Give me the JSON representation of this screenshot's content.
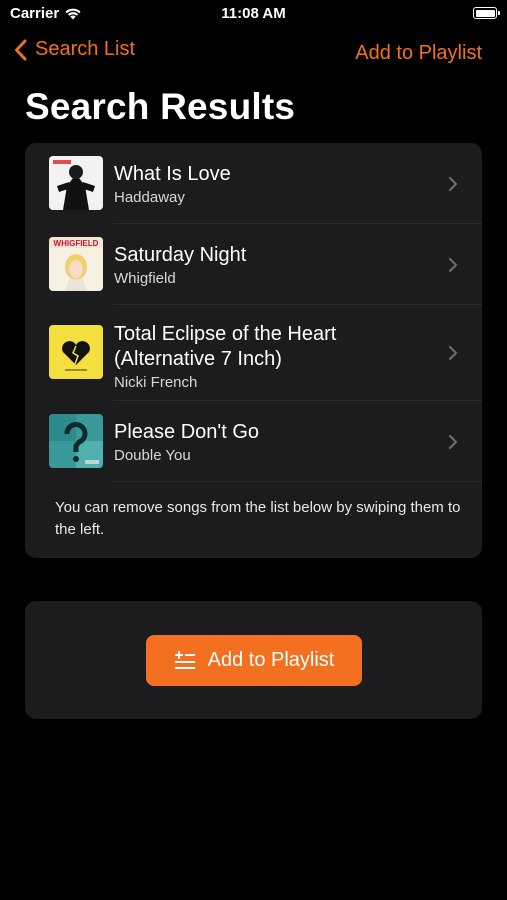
{
  "status_bar": {
    "carrier": "Carrier",
    "time": "11:08 AM",
    "wifi_icon": "wifi-icon",
    "battery_icon": "battery-icon"
  },
  "nav": {
    "back_label": "Search List",
    "back_icon": "chevron-left-icon",
    "action_label": "Add to Playlist"
  },
  "page_title": "Search Results",
  "songs": [
    {
      "title": "What Is Love",
      "artist": "Haddaway",
      "art_icon": "album-art"
    },
    {
      "title": "Saturday Night",
      "artist": "Whigfield",
      "art_icon": "album-art",
      "art_text": "WHIGFIELD"
    },
    {
      "title": "Total Eclipse of the Heart",
      "title_line2": "(Alternative 7 Inch)",
      "artist": "Nicki French",
      "art_icon": "album-art"
    },
    {
      "title": "Please Don't Go",
      "artist": "Double You",
      "art_icon": "album-art"
    }
  ],
  "hint": "You can remove songs from the list below by swiping them to the left.",
  "primary_button": {
    "label": "Add to Playlist",
    "icon": "playlist-add-icon"
  },
  "colors": {
    "accent": "#F37021",
    "background": "#000000",
    "card": "#1C1C1E",
    "divider": "#2C2C2E"
  }
}
